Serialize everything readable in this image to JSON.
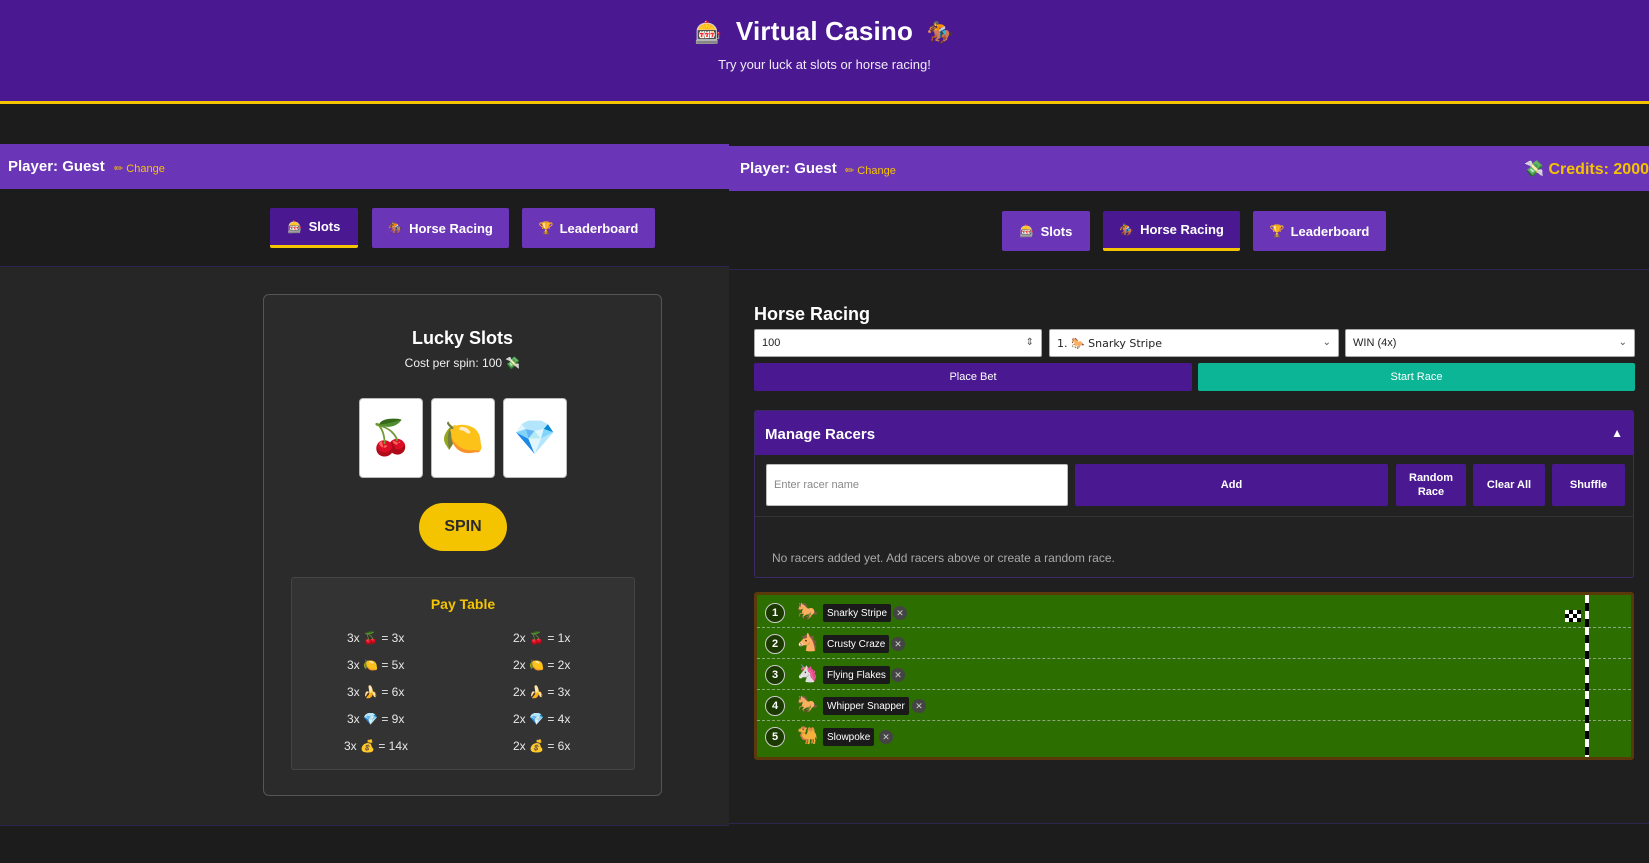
{
  "header": {
    "title": "Virtual Casino",
    "subtitle": "Try your luck at slots or horse racing!",
    "left_icon": "slot-machine-icon",
    "right_icon": "horse-racing-icon"
  },
  "left_panel": {
    "player_label": "Player: Guest",
    "change_label": "Change",
    "tabs": [
      {
        "label": "Slots",
        "active": true,
        "icon": "slot-machine-icon"
      },
      {
        "label": "Horse Racing",
        "active": false,
        "icon": "horse-racing-icon"
      },
      {
        "label": "Leaderboard",
        "active": false,
        "icon": "trophy-icon"
      }
    ],
    "slots": {
      "title": "Lucky Slots",
      "cost_text": "Cost per spin: 100",
      "reels": [
        "🍒",
        "🍋",
        "💎"
      ],
      "spin_label": "SPIN",
      "paytable_title": "Pay Table",
      "paytable_left": [
        {
          "count": "3x",
          "symbol": "🍒",
          "payout": "= 3x"
        },
        {
          "count": "3x",
          "symbol": "🍋",
          "payout": "= 5x"
        },
        {
          "count": "3x",
          "symbol": "🍌",
          "payout": "= 6x"
        },
        {
          "count": "3x",
          "symbol": "💎",
          "payout": "= 9x"
        },
        {
          "count": "3x",
          "symbol": "💰",
          "payout": "= 14x"
        }
      ],
      "paytable_right": [
        {
          "count": "2x",
          "symbol": "🍒",
          "payout": "= 1x"
        },
        {
          "count": "2x",
          "symbol": "🍋",
          "payout": "= 2x"
        },
        {
          "count": "2x",
          "symbol": "🍌",
          "payout": "= 3x"
        },
        {
          "count": "2x",
          "symbol": "💎",
          "payout": "= 4x"
        },
        {
          "count": "2x",
          "symbol": "💰",
          "payout": "= 6x"
        }
      ]
    }
  },
  "right_panel": {
    "player_label": "Player: Guest",
    "change_label": "Change",
    "credits_label": "Credits: 2000",
    "tabs": [
      {
        "label": "Slots",
        "active": false,
        "icon": "slot-machine-icon"
      },
      {
        "label": "Horse Racing",
        "active": true,
        "icon": "horse-racing-icon"
      },
      {
        "label": "Leaderboard",
        "active": false,
        "icon": "trophy-icon"
      }
    ],
    "horse_racing": {
      "title": "Horse Racing",
      "bet_amount": "100",
      "selected_horse": "1. 🐎 Snarky Stripe",
      "bet_type": "WIN (4x)",
      "place_bet_label": "Place Bet",
      "start_race_label": "Start Race",
      "manage_title": "Manage Racers",
      "racer_placeholder": "Enter racer name",
      "add_label": "Add",
      "random_race_label": "Random Race",
      "clear_all_label": "Clear All",
      "shuffle_label": "Shuffle",
      "no_racers_text": "No racers added yet. Add racers above or create a random race.",
      "racers": [
        {
          "number": "1",
          "emoji": "🐎",
          "name": "Snarky Stripe"
        },
        {
          "number": "2",
          "emoji": "🐴",
          "name": "Crusty Craze"
        },
        {
          "number": "3",
          "emoji": "🦄",
          "name": "Flying Flakes"
        },
        {
          "number": "4",
          "emoji": "🐎",
          "name": "Whipper Snapper"
        },
        {
          "number": "5",
          "emoji": "🐫",
          "name": "Slowpoke"
        }
      ]
    }
  },
  "colors": {
    "header_purple": "#4a1992",
    "bar_purple": "#6a35b6",
    "accent_gold": "#f5c400",
    "start_race_teal": "#0db597",
    "track_green": "#2c6e00"
  }
}
